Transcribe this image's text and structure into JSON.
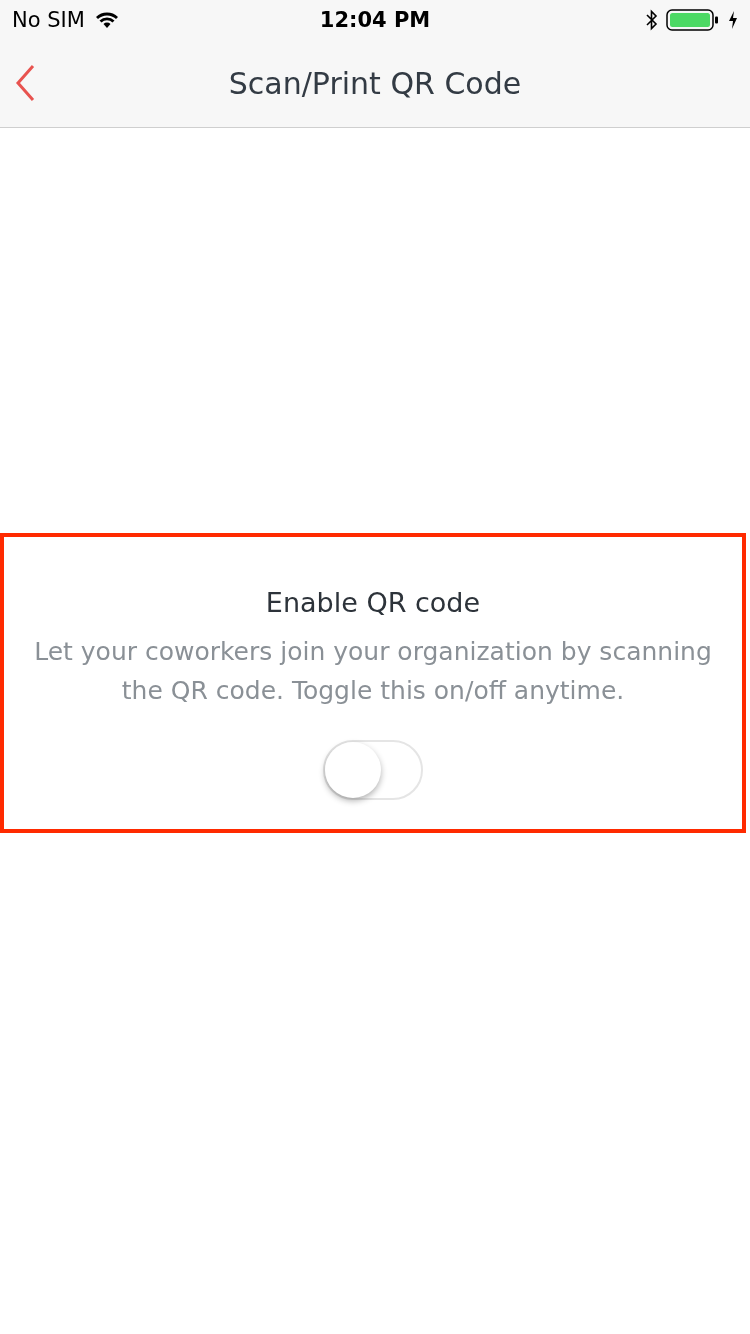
{
  "status_bar": {
    "carrier": "No SIM",
    "time": "12:04 PM"
  },
  "nav": {
    "title": "Scan/Print QR Code"
  },
  "qr_setting": {
    "highlighted": true,
    "title": "Enable QR code",
    "description": "Let your coworkers join your organization by scanning the QR code. Toggle this on/off anytime.",
    "on": false
  }
}
